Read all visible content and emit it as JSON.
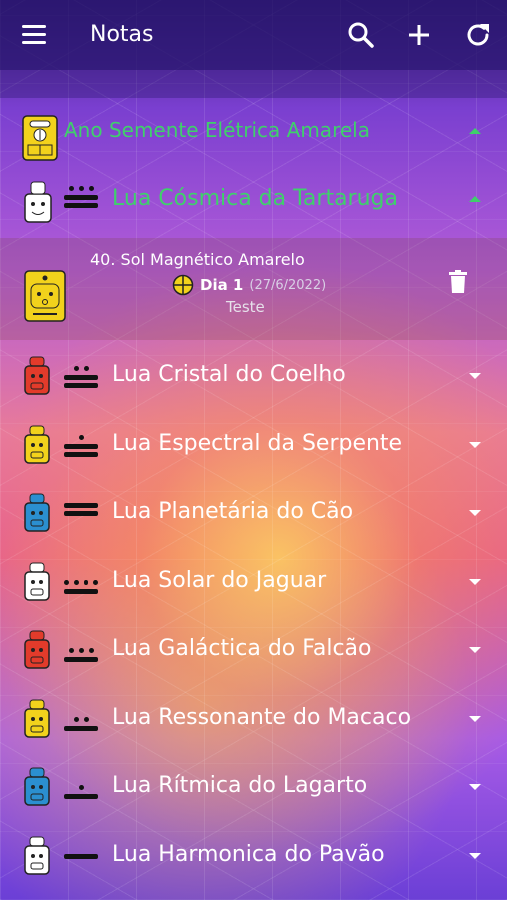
{
  "topbar": {
    "title": "Notas",
    "icons": [
      "menu-icon",
      "search-icon",
      "plus-icon",
      "refresh-icon"
    ]
  },
  "year": {
    "label": "Ano Semente Elétrica Amarela",
    "color": "#3fd06b",
    "expanded": true
  },
  "moon_open": {
    "label": "Lua Cósmica da Tartaruga",
    "color": "#3fd06b",
    "expanded": true
  },
  "note": {
    "title": "40. Sol Magnético Amarelo",
    "day_label": "Dia 1",
    "date": "(27/6/2022)",
    "text": "Teste"
  },
  "moons": [
    {
      "label": "Lua Cristal do Coelho",
      "glyph_color": "#e23b2b"
    },
    {
      "label": "Lua Espectral da Serpente",
      "glyph_color": "#f2d21c"
    },
    {
      "label": "Lua Planetária do Cão",
      "glyph_color": "#2b8fd0"
    },
    {
      "label": "Lua Solar do Jaguar",
      "glyph_color": "#ffffff"
    },
    {
      "label": "Lua Galáctica do Falcão",
      "glyph_color": "#e23b2b"
    },
    {
      "label": "Lua Ressonante do Macaco",
      "glyph_color": "#f2d21c"
    },
    {
      "label": "Lua Rítmica do Lagarto",
      "glyph_color": "#2b8fd0"
    },
    {
      "label": "Lua Harmonica do Pavão",
      "glyph_color": "#ffffff"
    }
  ]
}
